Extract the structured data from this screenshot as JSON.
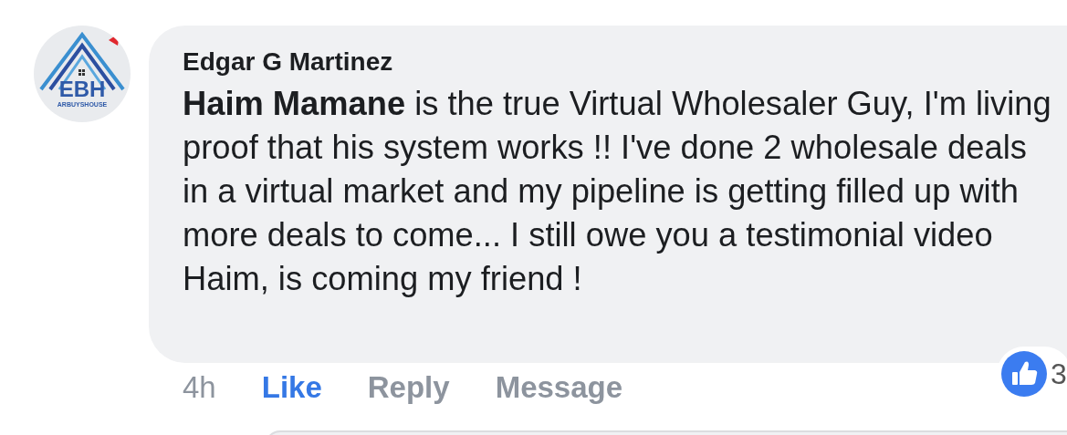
{
  "comment": {
    "avatar": {
      "logo_text": "EBH",
      "logo_tagline": "ARBUYSHOUSE"
    },
    "author": "Edgar G Martinez",
    "body": "**Haim Mamane** is the true Virtual Wholesaler Guy, I'm living proof that his system works !! I've done 2 wholesale deals in a virtual market and my pipeline is getting filled up with more deals to come... I still owe you a testimonial video Haim, is coming my friend !",
    "time": "4h",
    "actions": [
      {
        "label": "Like",
        "selected": true
      },
      {
        "label": "Reply",
        "selected": false
      },
      {
        "label": "Message",
        "selected": false
      }
    ],
    "reactions": {
      "count": "3"
    }
  }
}
